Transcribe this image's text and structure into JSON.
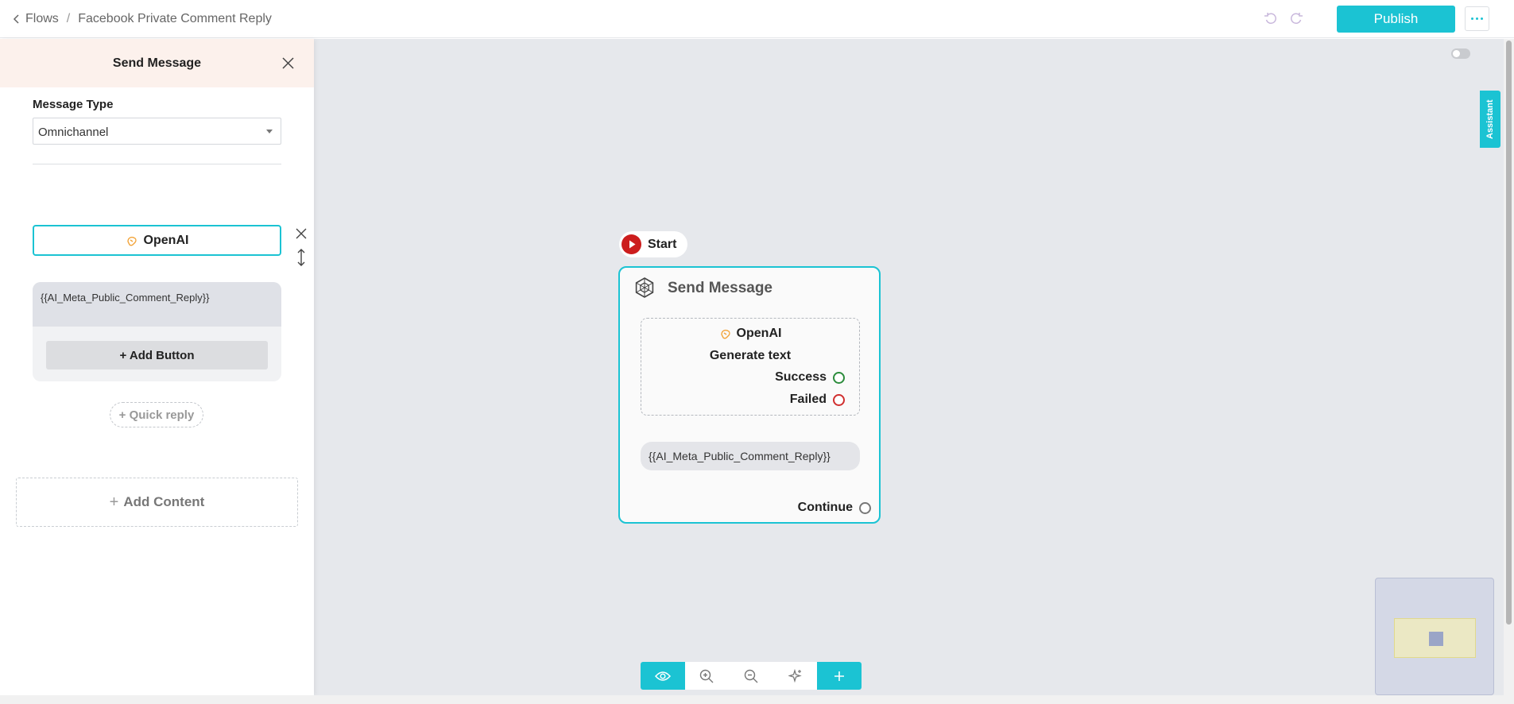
{
  "breadcrumb": {
    "parent": "Flows",
    "separator": "/",
    "current": "Facebook Private Comment Reply"
  },
  "header": {
    "publish_label": "Publish"
  },
  "panel": {
    "title": "Send Message",
    "message_type_label": "Message Type",
    "message_type_value": "Omnichannel",
    "channel_icons": [
      "messenger-icon",
      "whatsapp-icon",
      "telegram-icon",
      "chat-bubble-icon"
    ],
    "ai_card_label": "OpenAI",
    "message_text": "{{AI_Meta_Public_Comment_Reply}}",
    "add_button_label": "+ Add Button",
    "quick_reply_label": "+ Quick reply",
    "add_content_label": "Add Content"
  },
  "canvas": {
    "assistant_label": "Assistant",
    "start_label": "Start",
    "node": {
      "title": "Send Message",
      "ai_name": "OpenAI",
      "ai_action": "Generate text",
      "success_label": "Success",
      "failed_label": "Failed",
      "message_text": "{{AI_Meta_Public_Comment_Reply}}",
      "continue_label": "Continue"
    }
  },
  "colors": {
    "accent": "#1bc3d3",
    "success": "#2c8c3c",
    "failed": "#d02f2f",
    "panel_header": "#fcf1ec"
  }
}
